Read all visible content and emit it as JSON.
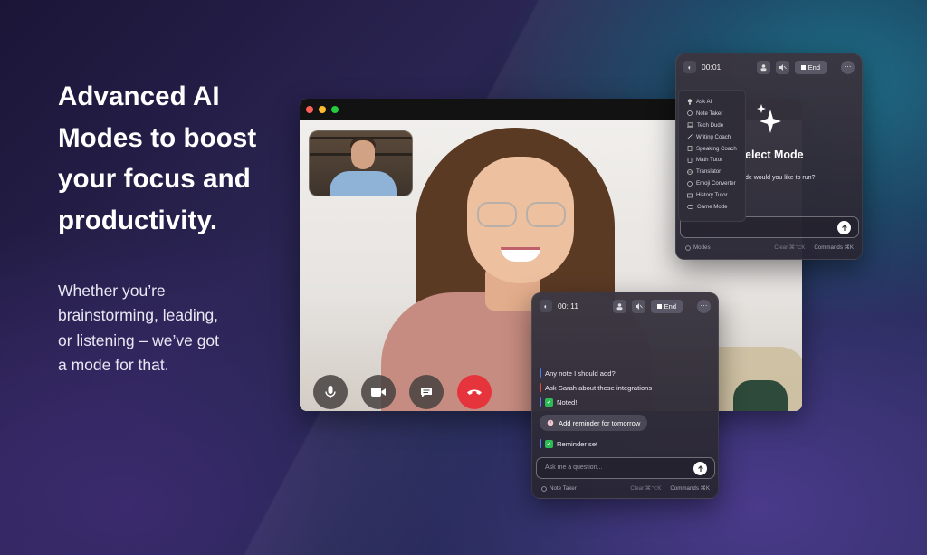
{
  "hero": {
    "headline_lines": [
      "Advanced AI",
      "Modes to boost",
      "your focus and",
      "productivity."
    ],
    "subtext_lines": [
      "Whether you’re",
      "brainstorming, leading,",
      "or listening – we’ve got",
      "a mode for that."
    ]
  },
  "video_call": {
    "window_buttons": [
      "close",
      "minimize",
      "zoom"
    ],
    "colors": {
      "close": "#ff5f57",
      "minimize": "#febc2e",
      "zoom": "#28c840",
      "end_call": "#e5343c"
    },
    "controls": [
      "microphone-icon",
      "camera-icon",
      "chat-icon",
      "end-call-icon"
    ]
  },
  "mode_panel": {
    "timer": "00:01",
    "end_label": "End",
    "title": "elect Mode",
    "question": "de would you like to run?",
    "menu_items": [
      "Ask AI",
      "Note Taker",
      "Tech Dude",
      "Writing Coach",
      "Speaking Coach",
      "Math Tutor",
      "Translator",
      "Emoji Converter",
      "History Tutor",
      "Game Mode"
    ],
    "footer_left": "Modes",
    "footer_clear": "Clear ⌘⌥K",
    "footer_commands": "Commands ⌘K"
  },
  "note_panel": {
    "timer": "00: 11",
    "end_label": "End",
    "messages": [
      {
        "text": "Any note I should add?",
        "bar_color": "#4d7cf0"
      },
      {
        "text": "Ask Sarah about these integrations",
        "bar_color": "#e8463c"
      },
      {
        "text": "Noted!",
        "bar_color": "#4d7cf0",
        "check": true
      }
    ],
    "reminder_chip": "Add reminder for tomorrow",
    "reminder_result": {
      "text": "Reminder set",
      "bar_color": "#4d7cf0",
      "check": true
    },
    "input_placeholder": "Ask me a question...",
    "footer_left": "Note Taker",
    "footer_clear": "Clear ⌘⌥K",
    "footer_commands": "Commands ⌘K"
  }
}
